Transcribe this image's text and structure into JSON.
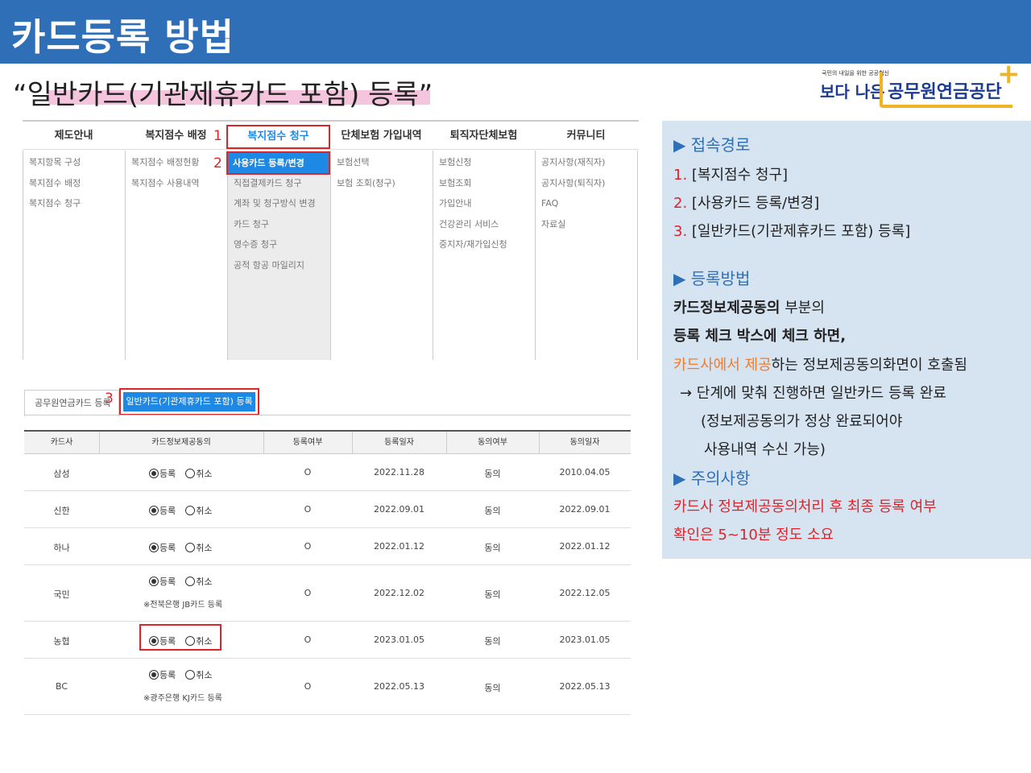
{
  "header": {
    "title": "카드등록 방법"
  },
  "subtitle": "“일반카드(기관제휴카드 포함) 등록”",
  "logo": {
    "slogan": "국민의 내일을 위한 공공혁신",
    "left_word": "보다 나은",
    "name": "공무원연금공단"
  },
  "menu": {
    "columns": [
      {
        "head": "제도안내",
        "items": [
          "복지항목 구성",
          "복지점수 배정",
          "복지점수 청구"
        ]
      },
      {
        "head": "복지점수 배정",
        "items": [
          "복지점수 배정현황",
          "복지점수 사용내역"
        ]
      },
      {
        "head": "복지점수 청구",
        "items": [
          "사용카드 등록/변경",
          "직접결제카드 청구",
          "계좌 및 청구방식 변경",
          "카드 청구",
          "영수증 청구",
          "공적 항공 마일리지"
        ]
      },
      {
        "head": "단체보험 가입내역",
        "items": [
          "보험선택",
          "보험 조회(청구)"
        ]
      },
      {
        "head": "퇴직자단체보험",
        "items": [
          "보험신청",
          "보험조회",
          "가입안내",
          "건강관리 서비스",
          "중지자/재가입신청"
        ]
      },
      {
        "head": "커뮤니티",
        "items": [
          "공지사항(재직자)",
          "공지사항(퇴직자)",
          "FAQ",
          "자료실"
        ]
      }
    ],
    "step1": "1",
    "step2": "2"
  },
  "tabs": {
    "inactive": "공무원연금카드 등록",
    "active": "일반카드(기관제휴카드 포함) 등록",
    "step3": "3"
  },
  "table": {
    "headers": [
      "카드사",
      "카드정보제공동의",
      "등록여부",
      "등록일자",
      "동의여부",
      "동의일자"
    ],
    "radio_on": "등록",
    "radio_off": "취소",
    "rows": [
      {
        "company": "삼성",
        "registered": "O",
        "reg_date": "2022.11.28",
        "agreed": "동의",
        "agree_date": "2010.04.05",
        "note": ""
      },
      {
        "company": "신한",
        "registered": "O",
        "reg_date": "2022.09.01",
        "agreed": "동의",
        "agree_date": "2022.09.01",
        "note": ""
      },
      {
        "company": "하나",
        "registered": "O",
        "reg_date": "2022.01.12",
        "agreed": "동의",
        "agree_date": "2022.01.12",
        "note": ""
      },
      {
        "company": "국민",
        "registered": "O",
        "reg_date": "2022.12.02",
        "agreed": "동의",
        "agree_date": "2022.12.05",
        "note": "※전북은행 JB카드 등록"
      },
      {
        "company": "농협",
        "registered": "O",
        "reg_date": "2023.01.05",
        "agreed": "동의",
        "agree_date": "2023.01.05",
        "note": ""
      },
      {
        "company": "BC",
        "registered": "O",
        "reg_date": "2022.05.13",
        "agreed": "동의",
        "agree_date": "2022.05.13",
        "note": "※광주은행 KJ카드 등록"
      }
    ]
  },
  "info": {
    "access_title": "▶ 접속경로",
    "access_steps": [
      {
        "num": "1.",
        "text": " [복지점수 청구]"
      },
      {
        "num": "2.",
        "text": " [사용카드 등록/변경]"
      },
      {
        "num": "3.",
        "text": " [일반카드(기관제휴카드 포함) 등록]"
      }
    ],
    "method_title": "▶ 등록방법",
    "m1_bold": "카드정보제공동의",
    "m1_rest": " 부분의",
    "m2": "등록 체크 박스에 체크 하면,",
    "m3_orange": "카드사에서 제공",
    "m3_rest": "하는 정보제공동의화면이 호출됨",
    "m4": "→ 단계에 맞춰 진행하면 일반카드 등록 완료",
    "m5": "(정보제공동의가 정상 완료되어야",
    "m6": "사용내역 수신 가능)",
    "caution_title": "▶ 주의사항",
    "c1": "카드사 정보제공동의처리 후 최종 등록 여부",
    "c2": "확인은 5~10분 정도 소요"
  },
  "colors": {
    "header_blue": "#2e6fb7",
    "accent_blue": "#1e88e5",
    "highlight_red": "#d9262b",
    "info_bg": "#d6e3f1"
  }
}
